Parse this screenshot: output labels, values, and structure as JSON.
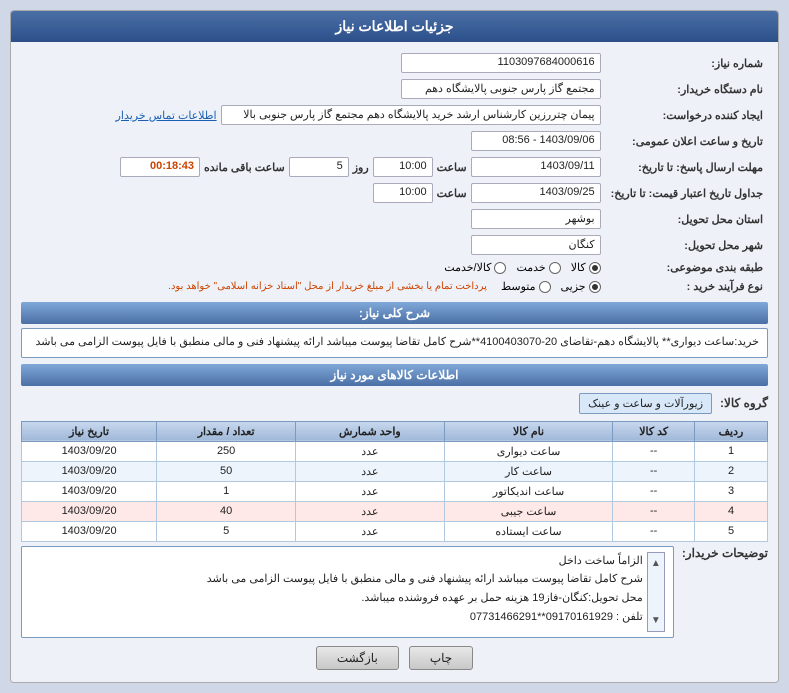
{
  "header": {
    "title": "جزئیات اطلاعات نیاز"
  },
  "fields": {
    "shomara_niaz_label": "شماره نیاز:",
    "shomara_niaz_value": "1103097684000616",
    "nam_dastgah_label": "نام دستگاه خریدار:",
    "nam_dastgah_value": "مجتمع گاز پارس جنوبی  پالایشگاه دهم",
    "ijad_konande_label": "ایجاد کننده درخواست:",
    "ijad_konande_value": "پیمان چتررزین کارشناس ارشد خرید پالایشگاه دهم مجتمع گاز پارس جنوبی  بالا",
    "ijad_konande_link": "اطلاعات تماس خریدار",
    "tarikh_label": "تاریخ و ساعت اعلان عمومی:",
    "tarikh_value": "1403/09/06 - 08:56",
    "mohlat_ersal_label": "مهلت ارسال پاسخ: تا تاریخ:",
    "mohlat_ersal_date": "1403/09/11",
    "mohlat_ersal_saat": "10:00",
    "mohlat_ersal_roz": "5",
    "mohlat_ersal_saat_mande": "00:18:43",
    "jadval_tarikh_label": "جداول تاریخ اعتبار قیمت: تا تاریخ:",
    "jadval_tarikh_date": "1403/09/25",
    "jadval_tarikh_saat": "10:00",
    "ostan_label": "استان محل تحویل:",
    "ostan_value": "بوشهر",
    "shahr_label": "شهر محل تحویل:",
    "shahr_value": "کنگان",
    "tabaqe_label": "طبقه بندی موضوعی:",
    "tabaqe_kala": "کالا",
    "tabaqe_khadamat": "خدمت",
    "tabaqe_kala_khadamat": "کالا/خدمت",
    "tabaqe_selected": "کالا",
    "noye_farayand_label": "نوع فرآیند خرید :",
    "noye_farayand_jozvi": "جزیی",
    "noye_farayand_mottaset": "متوسط",
    "noye_farayand_selected": "جزیی",
    "noye_farayand_note": "پرداخت تمام یا بخشی از مبلغ خریدار از محل \"اسناد خزانه اسلامی\" خواهد بود.",
    "sharh_koli_label": "شرح کلی نیاز:",
    "sharh_koli_value": "خرید:ساعت دیواری** پالایشگاه دهم-تقاضای 20-4100403070**شرح کامل تقاضا پیوست میباشد ارائه پیشنهاد فنی و مالی منطبق با فایل پیوست الزامی می باشد",
    "ettelaat_kala_label": "اطلاعات کالاهای مورد نیاز",
    "group_kala_label": "گروه کالا:",
    "group_kala_value": "زیورآلات و ساعت و عینک",
    "table_headers": {
      "radif": "ردیف",
      "code_kala": "کد کالا",
      "nam_kala": "نام کالا",
      "vahed": "واحد شمارش",
      "tedad": "تعداد / مقدار",
      "tarikh_niaz": "تاریخ نیاز"
    },
    "table_rows": [
      {
        "radif": "1",
        "code_kala": "--",
        "nam_kala": "ساعت دیواری",
        "vahed": "عدد",
        "tedad": "250",
        "tarikh": "1403/09/20"
      },
      {
        "radif": "2",
        "code_kala": "--",
        "nam_kala": "ساعت کار",
        "vahed": "عدد",
        "tedad": "50",
        "tarikh": "1403/09/20"
      },
      {
        "radif": "3",
        "code_kala": "--",
        "nam_kala": "ساعت اندیکاتور",
        "vahed": "عدد",
        "tedad": "1",
        "tarikh": "1403/09/20"
      },
      {
        "radif": "4",
        "code_kala": "--",
        "nam_kala": "ساعت جیبی",
        "vahed": "عدد",
        "tedad": "40",
        "tarikh": "1403/09/20"
      },
      {
        "radif": "5",
        "code_kala": "--",
        "nam_kala": "ساعت ایستاده",
        "vahed": "عدد",
        "tedad": "5",
        "tarikh": "1403/09/20"
      }
    ],
    "remarks_label": "توضیحات خریدار:",
    "remarks_line1": "الزاماً ساخت داخل",
    "remarks_line2": "شرح کامل تقاضا پیوست میباشد ارائه پیشنهاد فنی و مالی منطبق با فایل پیوست الزامی می باشد",
    "remarks_line3": "محل تحویل:کنگان-فاز19 هزینه حمل بر عهده فروشنده میباشد.",
    "remarks_line4": "تلفن : 09170161929**07731466291",
    "btn_chap": "چاپ",
    "btn_bazgasht": "بازگشت"
  }
}
